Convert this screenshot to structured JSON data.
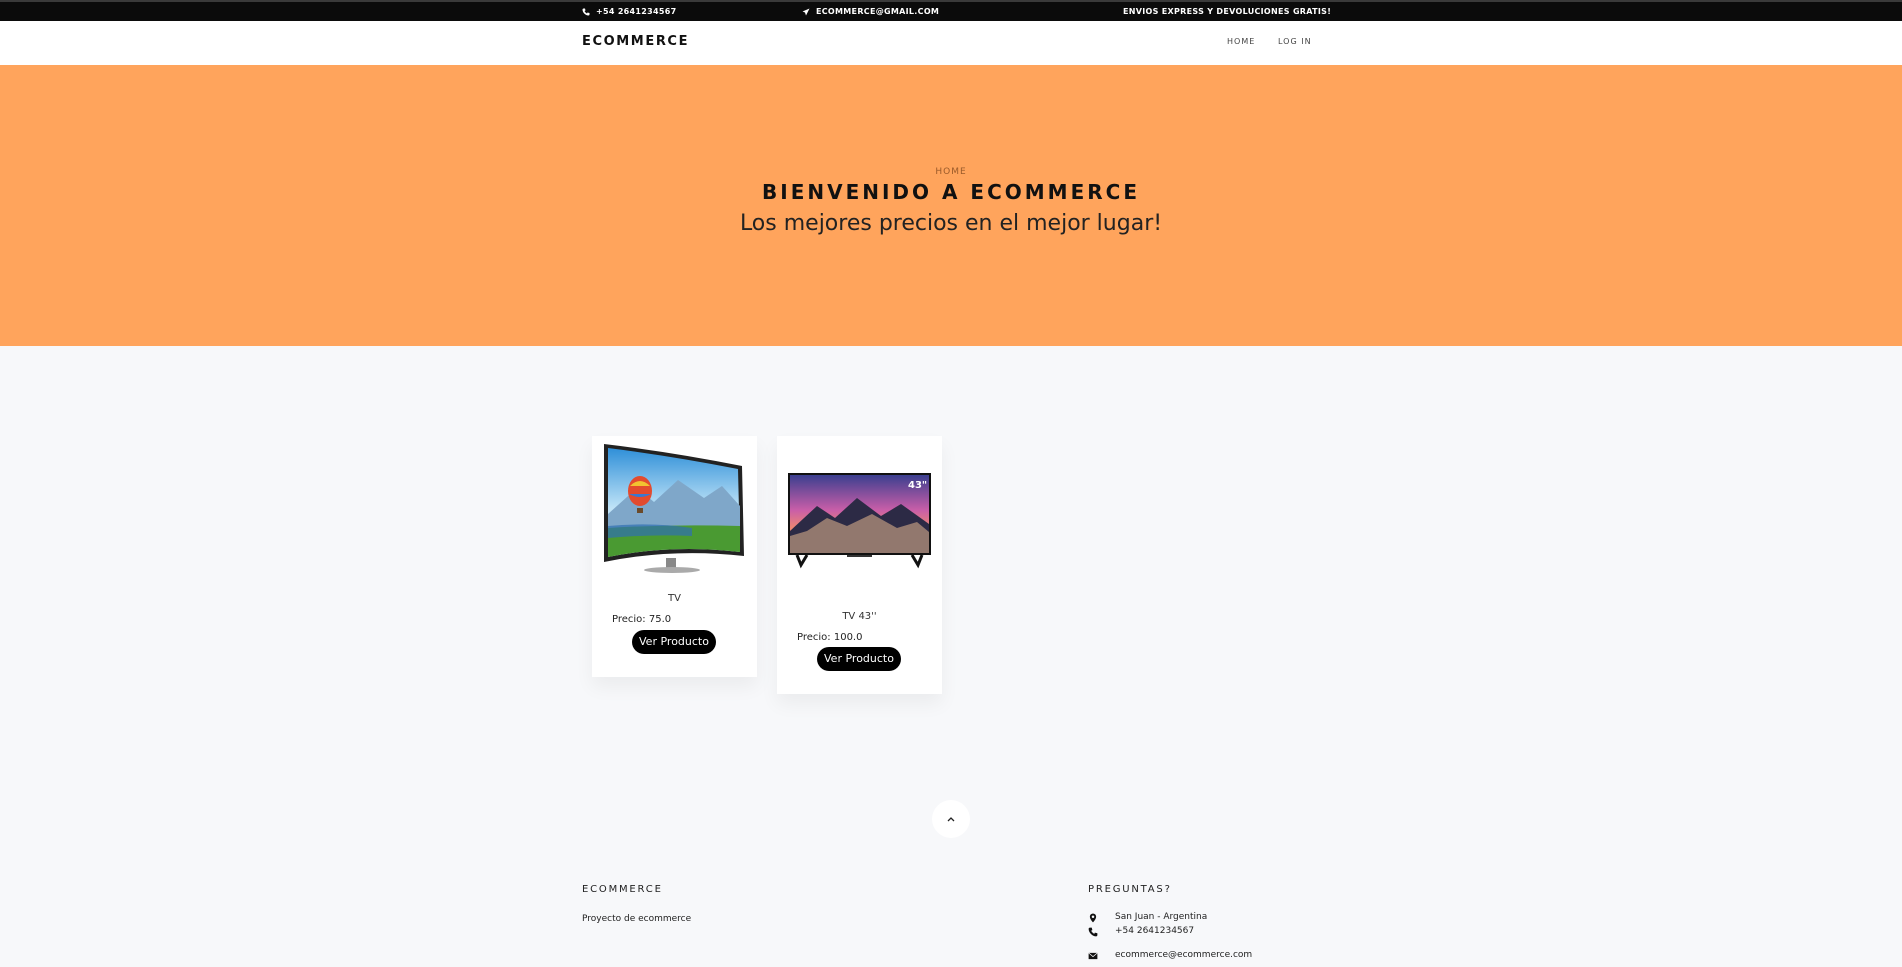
{
  "topbar": {
    "phone": "+54 2641234567",
    "email": "ECOMMERCE@GMAIL.COM",
    "promo": "ENVIOS EXPRESS Y DEVOLUCIONES GRATIS!"
  },
  "nav": {
    "brand": "ECOMMERCE",
    "links": [
      "HOME",
      "LOG IN"
    ]
  },
  "hero": {
    "breadcrumb": "HOME",
    "title": "BIENVENIDO A ECOMMERCE",
    "subtitle": "Los mejores precios en el mejor lugar!"
  },
  "products": [
    {
      "name": "TV",
      "price": "Precio: 75.0",
      "button": "Ver Producto"
    },
    {
      "name": "TV 43''",
      "price": "Precio: 100.0",
      "button": "Ver Producto"
    }
  ],
  "footer": {
    "brand_title": "ECOMMERCE",
    "description": "Proyecto de ecommerce",
    "contact_title": "PREGUNTAS?",
    "location": "San Juan - Argentina",
    "phone": "+54 2641234567",
    "email": "ecommerce@ecommerce.com"
  },
  "colors": {
    "hero_bg": "#ffa45c",
    "topbar_bg": "#0b0b0b",
    "button_bg": "#000000"
  }
}
